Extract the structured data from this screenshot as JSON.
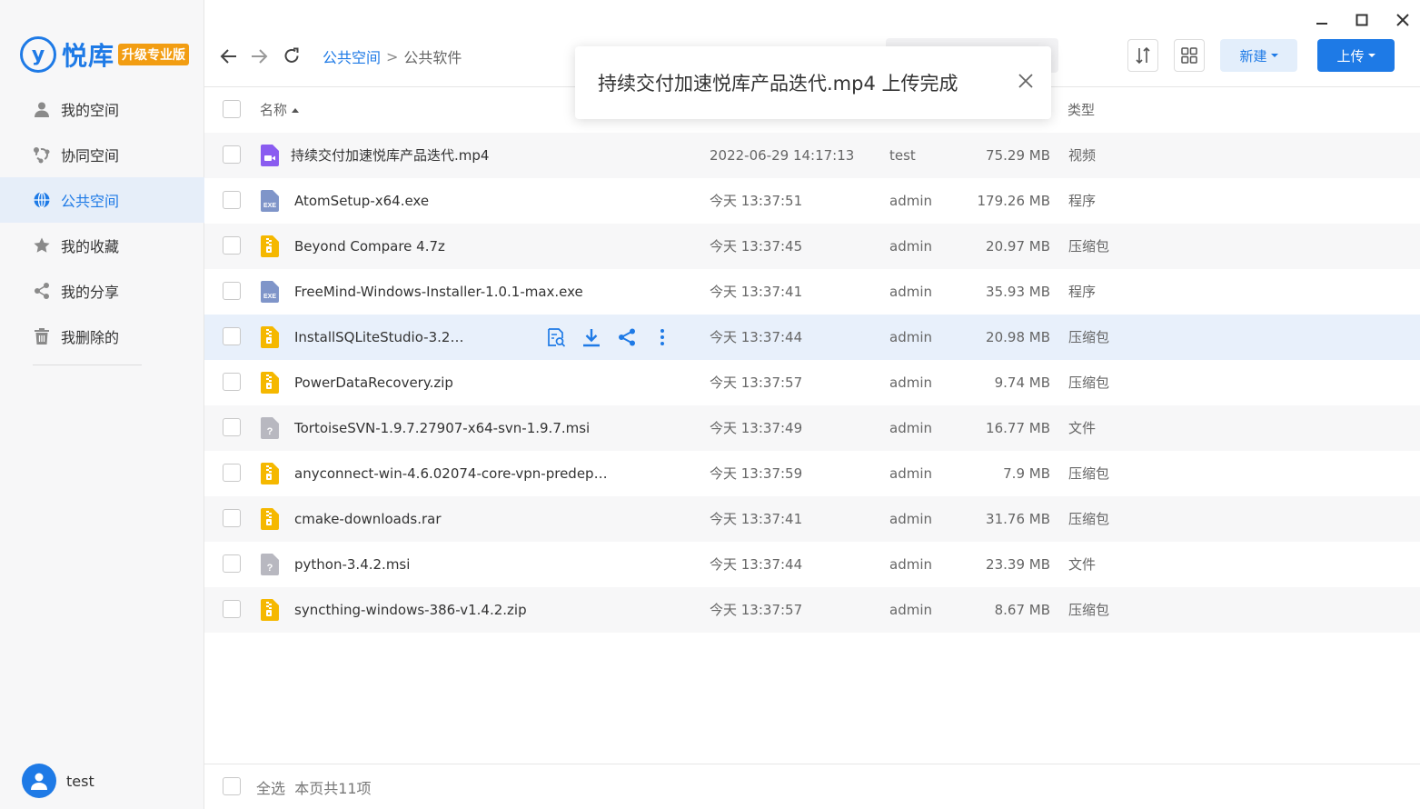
{
  "app": {
    "logo_text": "悦库",
    "logo_badge": "升级专业版",
    "logo_mark": "y"
  },
  "sidebar": {
    "items": [
      {
        "label": "我的空间",
        "icon": "user-icon",
        "active": false
      },
      {
        "label": "协同空间",
        "icon": "collab-icon",
        "active": false
      },
      {
        "label": "公共空间",
        "icon": "globe-icon",
        "active": true
      },
      {
        "label": "我的收藏",
        "icon": "star-icon",
        "active": false
      },
      {
        "label": "我的分享",
        "icon": "share-icon",
        "active": false
      },
      {
        "label": "我删除的",
        "icon": "trash-icon",
        "active": false
      }
    ]
  },
  "user": {
    "name": "test"
  },
  "toolbar": {
    "breadcrumb": {
      "root": "公共空间",
      "separator": ">",
      "current": "公共软件"
    },
    "search_placeholder": "",
    "new_label": "新建",
    "upload_label": "上传"
  },
  "toast": {
    "message": "持续交付加速悦库产品迭代.mp4 上传完成"
  },
  "table": {
    "columns": {
      "name": "名称",
      "type": "类型"
    },
    "rows": [
      {
        "name": "持续交付加速悦库产品迭代.mp4",
        "date": "2022-06-29 14:17:13",
        "owner": "test",
        "size": "75.29 MB",
        "type": "视频",
        "icon": "video"
      },
      {
        "name": "AtomSetup-x64.exe",
        "date": "今天 13:37:51",
        "owner": "admin",
        "size": "179.26 MB",
        "type": "程序",
        "icon": "exe"
      },
      {
        "name": "Beyond Compare 4.7z",
        "date": "今天 13:37:45",
        "owner": "admin",
        "size": "20.97 MB",
        "type": "压缩包",
        "icon": "zip"
      },
      {
        "name": "FreeMind-Windows-Installer-1.0.1-max.exe",
        "date": "今天 13:37:41",
        "owner": "admin",
        "size": "35.93 MB",
        "type": "程序",
        "icon": "exe"
      },
      {
        "name": "InstallSQLiteStudio-3.2…",
        "date": "今天 13:37:44",
        "owner": "admin",
        "size": "20.98 MB",
        "type": "压缩包",
        "icon": "zip"
      },
      {
        "name": "PowerDataRecovery.zip",
        "date": "今天 13:37:57",
        "owner": "admin",
        "size": "9.74 MB",
        "type": "压缩包",
        "icon": "zip"
      },
      {
        "name": "TortoiseSVN-1.9.7.27907-x64-svn-1.9.7.msi",
        "date": "今天 13:37:49",
        "owner": "admin",
        "size": "16.77 MB",
        "type": "文件",
        "icon": "unknown"
      },
      {
        "name": "anyconnect-win-4.6.02074-core-vpn-predep…",
        "date": "今天 13:37:59",
        "owner": "admin",
        "size": "7.9 MB",
        "type": "压缩包",
        "icon": "zip"
      },
      {
        "name": "cmake-downloads.rar",
        "date": "今天 13:37:41",
        "owner": "admin",
        "size": "31.76 MB",
        "type": "压缩包",
        "icon": "zip"
      },
      {
        "name": "python-3.4.2.msi",
        "date": "今天 13:37:44",
        "owner": "admin",
        "size": "23.39 MB",
        "type": "文件",
        "icon": "unknown"
      },
      {
        "name": "syncthing-windows-386-v1.4.2.zip",
        "date": "今天 13:37:57",
        "owner": "admin",
        "size": "8.67 MB",
        "type": "压缩包",
        "icon": "zip"
      }
    ],
    "hover_row": 4
  },
  "footer": {
    "select_all": "全选",
    "count_text": "本页共11项"
  },
  "colors": {
    "accent": "#1e7ae6",
    "badge": "#f29d12",
    "zip": "#f5b800",
    "video": "#8a5cf0",
    "exe": "#7f95c9",
    "unknown": "#b8b8c0"
  }
}
